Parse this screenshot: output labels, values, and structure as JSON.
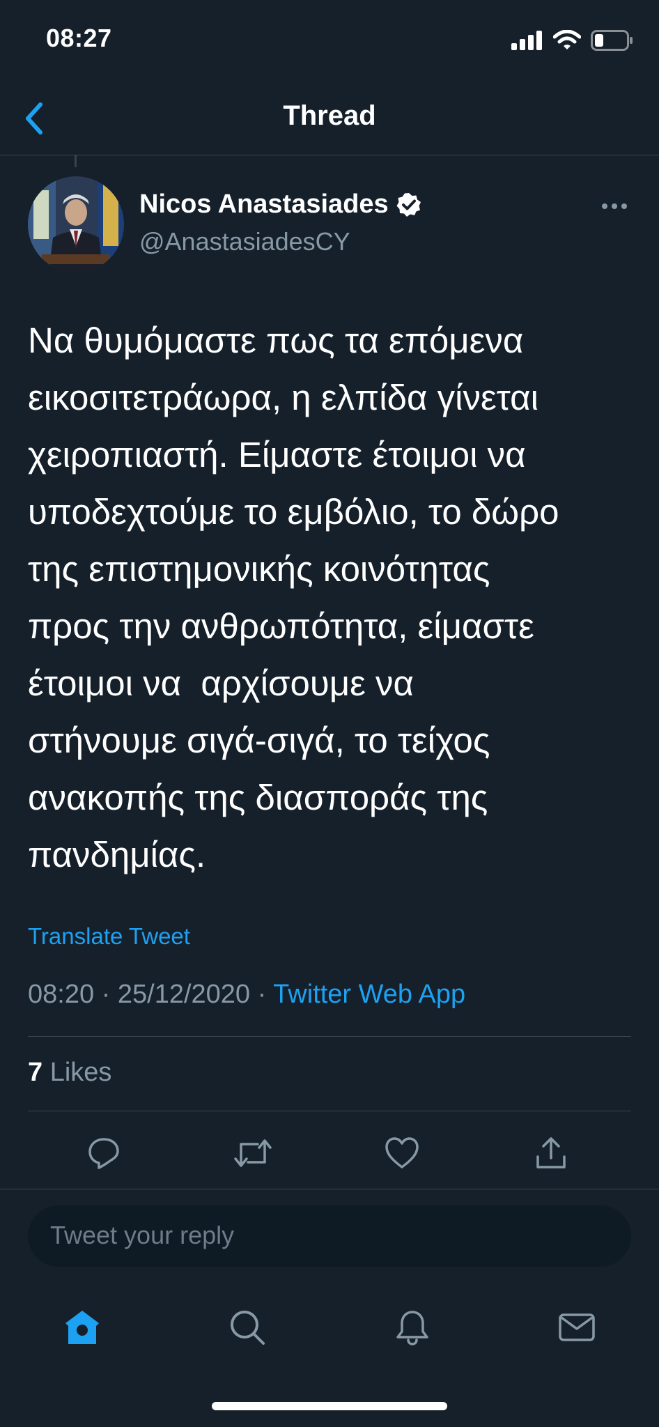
{
  "status_bar": {
    "time": "08:27"
  },
  "header": {
    "title": "Thread"
  },
  "tweet": {
    "author_name": "Nicos Anastasiades",
    "handle": "@AnastasiadesCY",
    "verified": true,
    "text": "Να θυμόμαστε πως τα επόμενα\nεικοσιτετράωρα, η ελπίδα γίνεται\nχειροπιαστή. Είμαστε έτοιμοι να\nυποδεχτούμε το εμβόλιο, το δώρο\nτης επιστημονικής κοινότητας\nπρος την ανθρωπότητα, είμαστε\nέτοιμοι να  αρχίσουμε να\nστήνουμε σιγά-σιγά, το τείχος\nανακοπής της διασποράς της\nπανδημίας.",
    "translate_label": "Translate Tweet",
    "time": "08:20",
    "date": "25/12/2020",
    "dot": "·",
    "source": "Twitter Web App",
    "likes_count": "7",
    "likes_label": "Likes"
  },
  "reply": {
    "placeholder": "Tweet your reply"
  },
  "icons": {
    "back": "chevron-left-icon",
    "more": "more-horizontal-icon",
    "reply": "comment-icon",
    "retweet": "retweet-icon",
    "like": "heart-icon",
    "share": "share-icon",
    "home": "home-icon",
    "search": "search-icon",
    "notifications": "bell-icon",
    "messages": "mail-icon"
  },
  "colors": {
    "background": "#15202b",
    "accent": "#1da1f2",
    "secondary_text": "#8899a6",
    "divider": "#38444d"
  }
}
